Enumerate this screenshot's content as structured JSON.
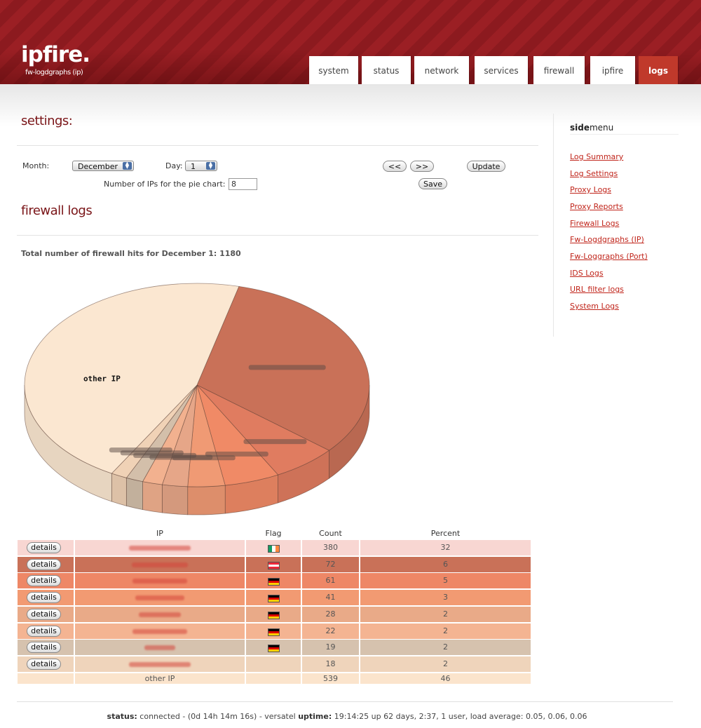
{
  "header": {
    "logo": "ipfire.",
    "subtitle": "fw-logdgraphs (ip)",
    "tabs": [
      {
        "label": "system",
        "active": false
      },
      {
        "label": "status",
        "active": false
      },
      {
        "label": "network",
        "active": false
      },
      {
        "label": "services",
        "active": false
      },
      {
        "label": "firewall",
        "active": false
      },
      {
        "label": "ipfire",
        "active": false
      },
      {
        "label": "logs",
        "active": true
      }
    ],
    "accent_color": "#9b1f24"
  },
  "settings": {
    "title": "settings:",
    "month_label": "Month:",
    "month_value": "December",
    "day_label": "Day:",
    "day_value": "1",
    "prev_button": "<<",
    "next_button": ">>",
    "update_button": "Update",
    "pie_count_label": "Number of IPs for the pie chart:",
    "pie_count_value": "8",
    "save_button": "Save"
  },
  "firewall": {
    "title": "firewall logs",
    "total_text": "Total number of firewall hits for December 1: 1180"
  },
  "chart_data": {
    "type": "pie",
    "slices": [
      {
        "label": "",
        "value": 380,
        "color": "#c97158"
      },
      {
        "label": "",
        "value": 72,
        "color": "#e07c60"
      },
      {
        "label": "",
        "value": 61,
        "color": "#f08a66"
      },
      {
        "label": "",
        "value": 41,
        "color": "#f09a74"
      },
      {
        "label": "",
        "value": 28,
        "color": "#e6a688"
      },
      {
        "label": "",
        "value": 22,
        "color": "#f2b18f"
      },
      {
        "label": "",
        "value": 19,
        "color": "#d3bfaa"
      },
      {
        "label": "",
        "value": 18,
        "color": "#f0d2b6"
      },
      {
        "label": "other IP",
        "value": 539,
        "color": "#fbe7d1"
      }
    ]
  },
  "table": {
    "headers": {
      "ip": "IP",
      "flag": "Flag",
      "count": "Count",
      "percent": "Percent"
    },
    "details_label": "details",
    "rows": [
      {
        "has_details": true,
        "ip": "",
        "flag": "ireland",
        "count": "380",
        "percent": "32",
        "color": "#f8d6d2"
      },
      {
        "has_details": true,
        "ip": "",
        "flag": "austria",
        "count": "72",
        "percent": "6",
        "color": "#c97158"
      },
      {
        "has_details": true,
        "ip": "",
        "flag": "germany",
        "count": "61",
        "percent": "5",
        "color": "#ee8766"
      },
      {
        "has_details": true,
        "ip": "",
        "flag": "germany",
        "count": "41",
        "percent": "3",
        "color": "#f29a72"
      },
      {
        "has_details": true,
        "ip": "",
        "flag": "germany",
        "count": "28",
        "percent": "2",
        "color": "#e9aa88"
      },
      {
        "has_details": true,
        "ip": "",
        "flag": "germany",
        "count": "22",
        "percent": "2",
        "color": "#f4b492"
      },
      {
        "has_details": true,
        "ip": "",
        "flag": "germany",
        "count": "19",
        "percent": "2",
        "color": "#d6c2ae"
      },
      {
        "has_details": true,
        "ip": "",
        "flag": "",
        "count": "18",
        "percent": "2",
        "color": "#efd4bb"
      },
      {
        "has_details": false,
        "ip": "other IP",
        "flag": "",
        "count": "539",
        "percent": "46",
        "color": "#fbe4cc"
      }
    ]
  },
  "sidebar": {
    "title_bold": "side",
    "title_rest": "menu",
    "items": [
      "Log Summary",
      "Log Settings",
      "Proxy Logs",
      "Proxy Reports",
      "Firewall Logs",
      "Fw-Logdgraphs (IP)",
      "Fw-Loggraphs (Port)",
      "IDS Logs",
      "URL filter logs",
      "System Logs"
    ]
  },
  "footer": {
    "status_label": "status:",
    "status_value": "connected - (0d 14h 14m 16s) - versatel",
    "uptime_label": "uptime:",
    "uptime_value": "19:14:25 up 62 days, 2:37, 1 user, load average: 0.05, 0.06, 0.06"
  }
}
